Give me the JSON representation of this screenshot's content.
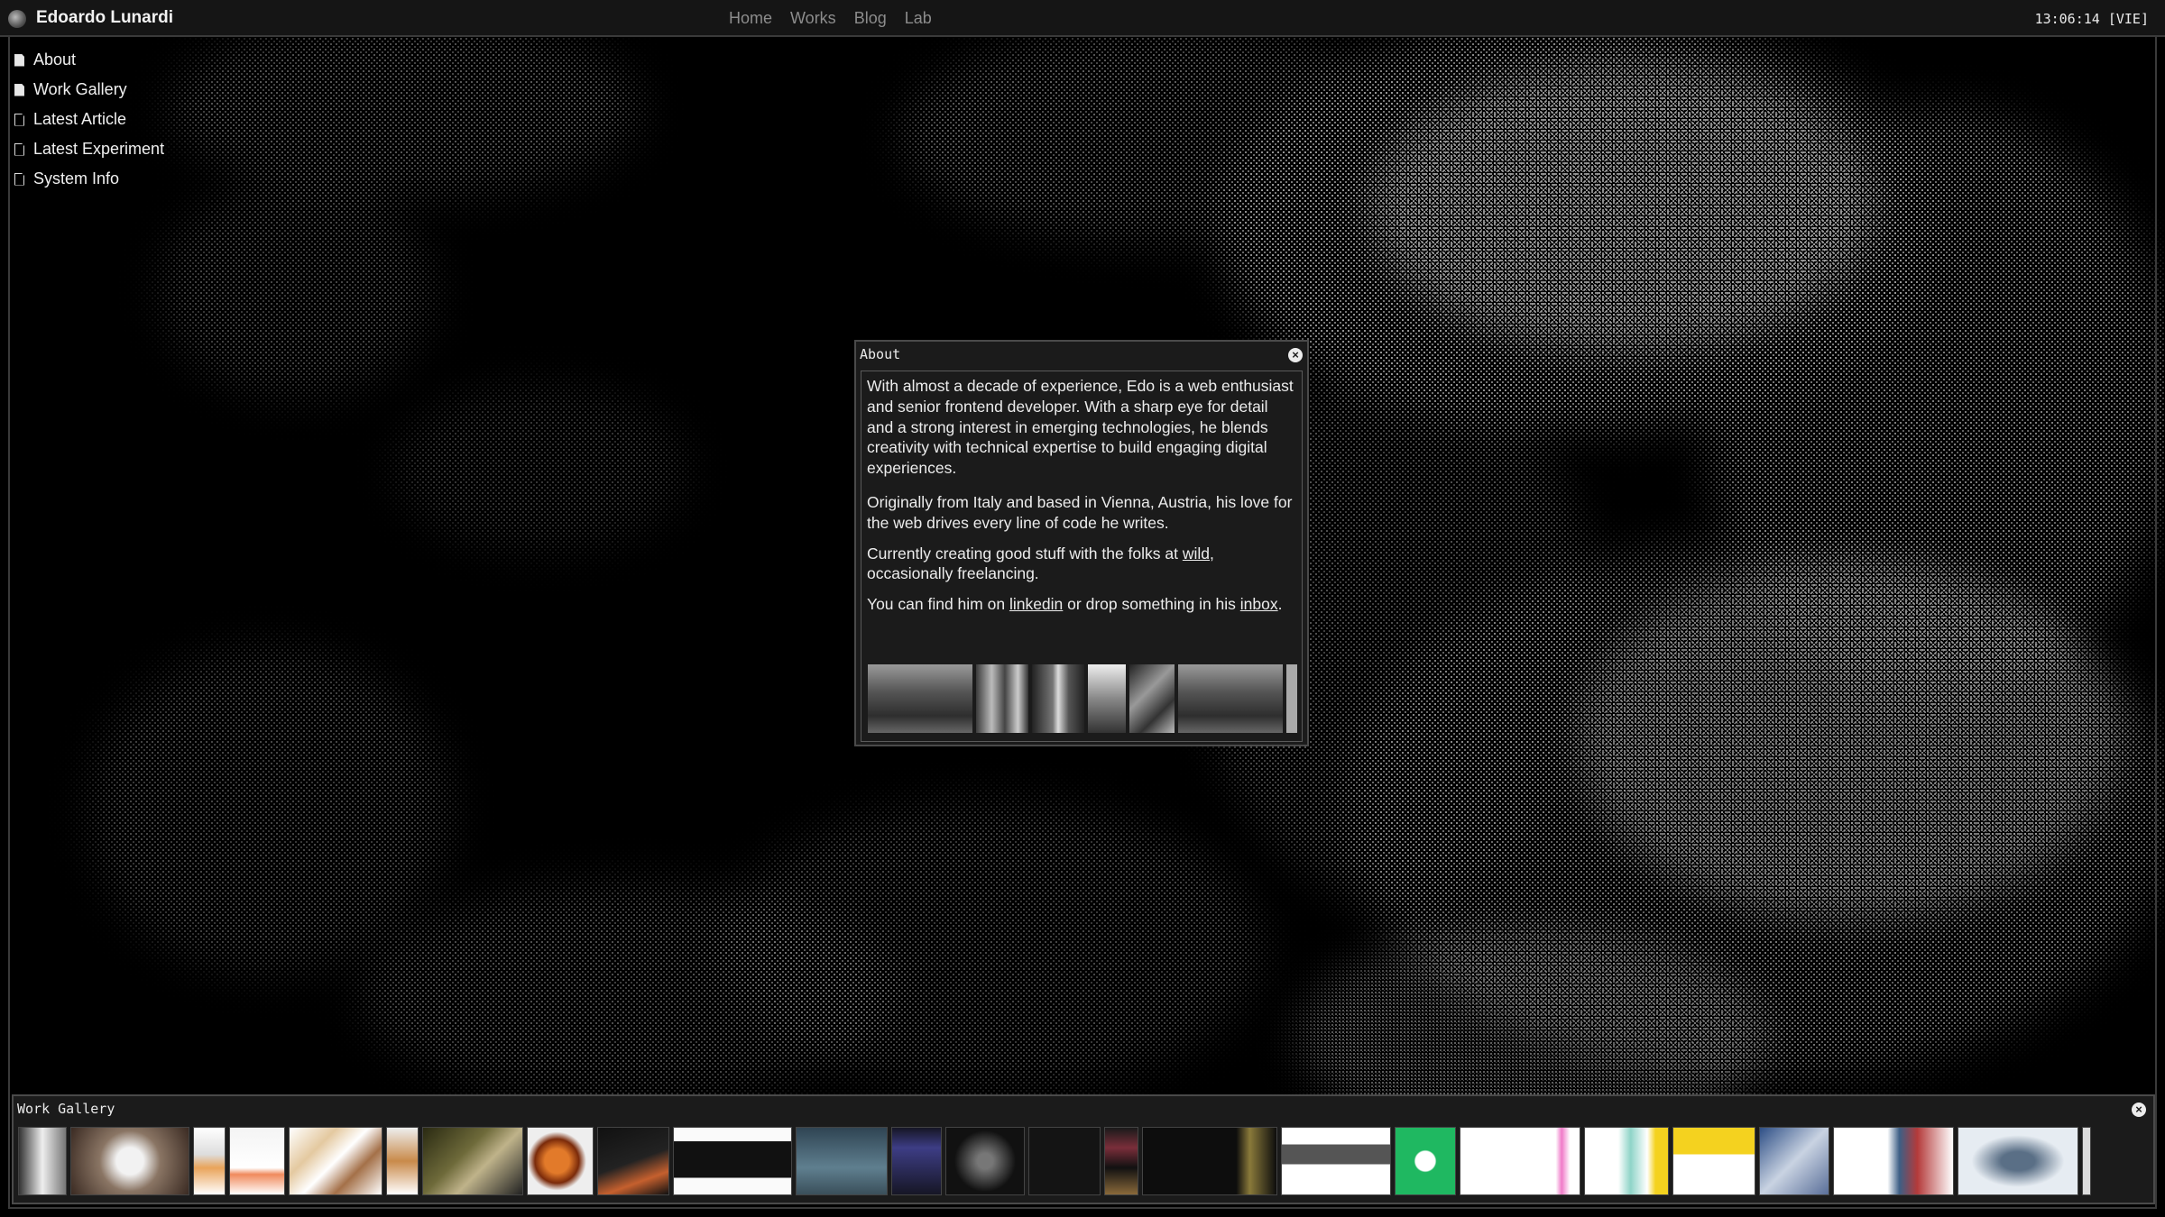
{
  "header": {
    "site_name": "Edoardo Lunardi",
    "nav": [
      "Home",
      "Works",
      "Blog",
      "Lab"
    ],
    "clock": "13:06:14 [VIE]"
  },
  "desktop": {
    "items": [
      {
        "label": "About",
        "open": true
      },
      {
        "label": "Work Gallery",
        "open": true
      },
      {
        "label": "Latest Article",
        "open": false
      },
      {
        "label": "Latest Experiment",
        "open": false
      },
      {
        "label": "System Info",
        "open": false
      }
    ]
  },
  "about_window": {
    "title": "About",
    "p1": "With almost a decade of experience, Edo is a web enthusiast and senior frontend developer. With a sharp eye for detail and a strong interest in emerging technologies, he blends creativity with technical expertise to build engaging digital experiences.",
    "p2": "Originally from Italy and based in Vienna, Austria, his love for the web drives every line of code he writes.",
    "p3_before": "Currently creating good stuff with the folks at ",
    "p3_link": "wild",
    "p3_after": ", occasionally freelancing.",
    "p4_before": "You can find him on ",
    "p4_link1": "linkedin",
    "p4_middle": " or drop something in his ",
    "p4_link2": "inbox",
    "p4_after": "."
  },
  "gallery_window": {
    "title": "Work Gallery"
  },
  "colors": {
    "background": "#000000",
    "window_bg": "#1b1b1b",
    "accent_green": "#1fb861",
    "accent_yellow": "#f4d21f",
    "accent_pink": "#f07ac8"
  }
}
